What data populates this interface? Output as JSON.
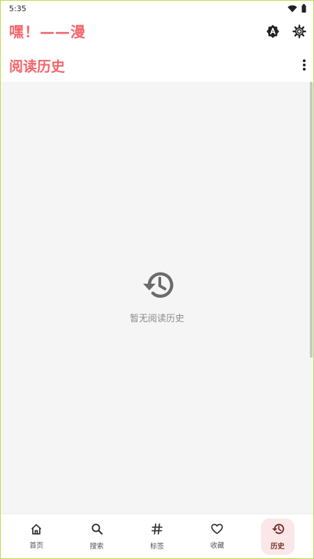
{
  "status_bar": {
    "time": "5:35",
    "icons": [
      "wifi-icon",
      "battery-icon"
    ]
  },
  "app_header": {
    "title": "嘿！——漫",
    "actions": [
      "theme-a-icon",
      "settings-gear-icon"
    ]
  },
  "page_header": {
    "title": "阅读历史",
    "menu_icon": "more-vert-icon"
  },
  "empty_state": {
    "icon": "history-icon",
    "text": "暂无阅读历史"
  },
  "bottom_nav": {
    "items": [
      {
        "label": "首页",
        "icon": "home-icon",
        "active": false
      },
      {
        "label": "搜索",
        "icon": "search-icon",
        "active": false
      },
      {
        "label": "标签",
        "icon": "hash-tag-icon",
        "active": false
      },
      {
        "label": "收藏",
        "icon": "heart-icon",
        "active": false
      },
      {
        "label": "历史",
        "icon": "history-icon",
        "active": true
      }
    ]
  },
  "colors": {
    "accent": "#f2656a",
    "background": "#f5f5f5",
    "active_nav_bg": "#fbe7e7"
  }
}
